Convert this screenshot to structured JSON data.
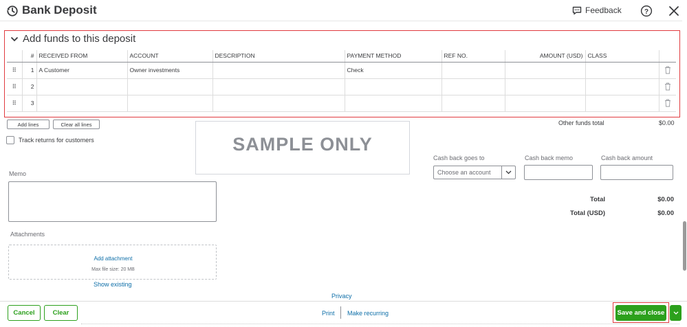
{
  "header": {
    "title": "Bank Deposit",
    "feedback_label": "Feedback"
  },
  "section": {
    "title": "Add funds to this deposit"
  },
  "table": {
    "columns": [
      "#",
      "RECEIVED FROM",
      "ACCOUNT",
      "DESCRIPTION",
      "PAYMENT METHOD",
      "REF NO.",
      "AMOUNT (USD)",
      "CLASS"
    ],
    "rows": [
      {
        "num": "1",
        "received_from": "A Customer",
        "account": "Owner investments",
        "description": "",
        "payment_method": "Check",
        "ref_no": "",
        "amount": "",
        "class": ""
      },
      {
        "num": "2",
        "received_from": "",
        "account": "",
        "description": "",
        "payment_method": "",
        "ref_no": "",
        "amount": "",
        "class": ""
      },
      {
        "num": "3",
        "received_from": "",
        "account": "",
        "description": "",
        "payment_method": "",
        "ref_no": "",
        "amount": "",
        "class": ""
      }
    ]
  },
  "actions": {
    "add_lines": "Add lines",
    "clear_all_lines": "Clear all lines",
    "track_returns": "Track returns for customers"
  },
  "other_funds": {
    "label": "Other funds total",
    "value": "$0.00"
  },
  "watermark": "SAMPLE ONLY",
  "cash_back": {
    "goes_to_label": "Cash back goes to",
    "goes_to_placeholder": "Choose an account",
    "memo_label": "Cash back memo",
    "amount_label": "Cash back amount"
  },
  "totals": {
    "total_label": "Total",
    "total_value": "$0.00",
    "total_usd_label": "Total (USD)",
    "total_usd_value": "$0.00"
  },
  "memo": {
    "label": "Memo"
  },
  "attachments": {
    "label": "Attachments",
    "add_attachment": "Add attachment",
    "max_size": "Max file size: 20 MB",
    "show_existing": "Show existing"
  },
  "footer": {
    "privacy": "Privacy",
    "cancel": "Cancel",
    "clear": "Clear",
    "print": "Print",
    "make_recurring": "Make recurring",
    "save_and_close": "Save and close"
  },
  "colors": {
    "accent_green": "#2ca01c",
    "highlight_red": "#e03a3e",
    "link_blue": "#0d6ea8"
  }
}
